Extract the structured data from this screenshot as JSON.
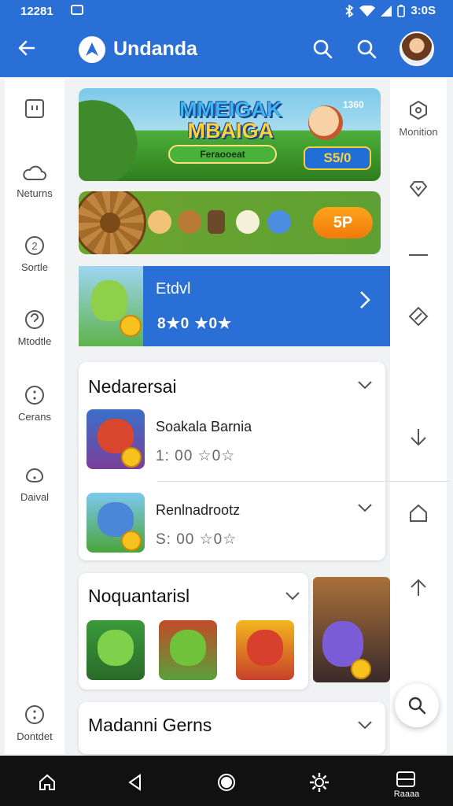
{
  "status_bar": {
    "time": "12281",
    "right_text": "3:0S"
  },
  "app_bar": {
    "title": "Undanda"
  },
  "left_rail": {
    "items": [
      {
        "label": "",
        "icon": "square-icon"
      },
      {
        "label": "Neturns",
        "icon": "cloud-icon"
      },
      {
        "label": "Sortle",
        "icon": "number-two-icon"
      },
      {
        "label": "Mtodtle",
        "icon": "circle-badge-icon"
      },
      {
        "label": "Cerans",
        "icon": "dots-circle-icon"
      },
      {
        "label": "Daival",
        "icon": "shield-icon"
      },
      {
        "label": "Dontdet",
        "icon": "dots-circle-icon"
      }
    ]
  },
  "right_rail": {
    "items": [
      {
        "label": "Monition",
        "icon": "hexagon-icon"
      },
      {
        "label": "",
        "icon": "diamond-icon"
      },
      {
        "label": "",
        "icon": "minus-icon"
      },
      {
        "label": "",
        "icon": "diamond-square-icon"
      },
      {
        "label": "",
        "icon": "arrow-down-icon"
      },
      {
        "label": "",
        "icon": "home-outline-icon"
      },
      {
        "label": "",
        "icon": "arrow-up-icon"
      }
    ]
  },
  "banner": {
    "title_line1": "MMEIGAK",
    "title_line2": "MBAIGA",
    "button": "Feraooeat",
    "price": "S5/0",
    "score": "1360"
  },
  "wheel_card": {
    "button": "5P"
  },
  "event_card": {
    "title": "Etdvl",
    "rating": "8★0 ★0★"
  },
  "section1": {
    "title": "Nedarersai",
    "items": [
      {
        "name": "Soakala Barnia",
        "rating": "1: 00 ☆0☆"
      },
      {
        "name": "Renlnadrootz",
        "rating": "S: 00 ☆0☆"
      }
    ]
  },
  "section2": {
    "title": "Noquantarisl"
  },
  "section3": {
    "title": "Madanni Gerns"
  },
  "nav": {
    "label": "Raaaa"
  },
  "colors": {
    "primary": "#2a6fd6",
    "accent": "#f07a0b",
    "green": "#5ea033"
  }
}
